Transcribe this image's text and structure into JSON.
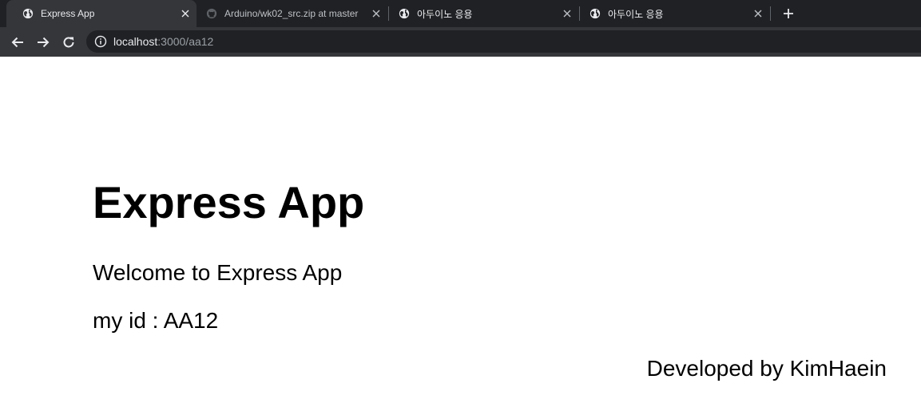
{
  "browser": {
    "tabs": [
      {
        "title": "Express App",
        "favicon": "globe-icon",
        "active": true
      },
      {
        "title": "Arduino/wk02_src.zip at master",
        "favicon": "github-icon",
        "active": false
      },
      {
        "title": "아두이노 응용",
        "favicon": "globe-icon",
        "active": false
      },
      {
        "title": "아두이노 응용",
        "favicon": "globe-icon",
        "active": false
      }
    ],
    "address": {
      "host": "localhost",
      "path": ":3000/aa12"
    },
    "colors": {
      "tabstrip": "#202124",
      "toolbar": "#35363a",
      "text": "#e8eaed"
    }
  },
  "page": {
    "heading": "Express App",
    "welcome": "Welcome to Express App",
    "my_id": "my id : AA12",
    "footer": "Developed by KimHaein"
  }
}
